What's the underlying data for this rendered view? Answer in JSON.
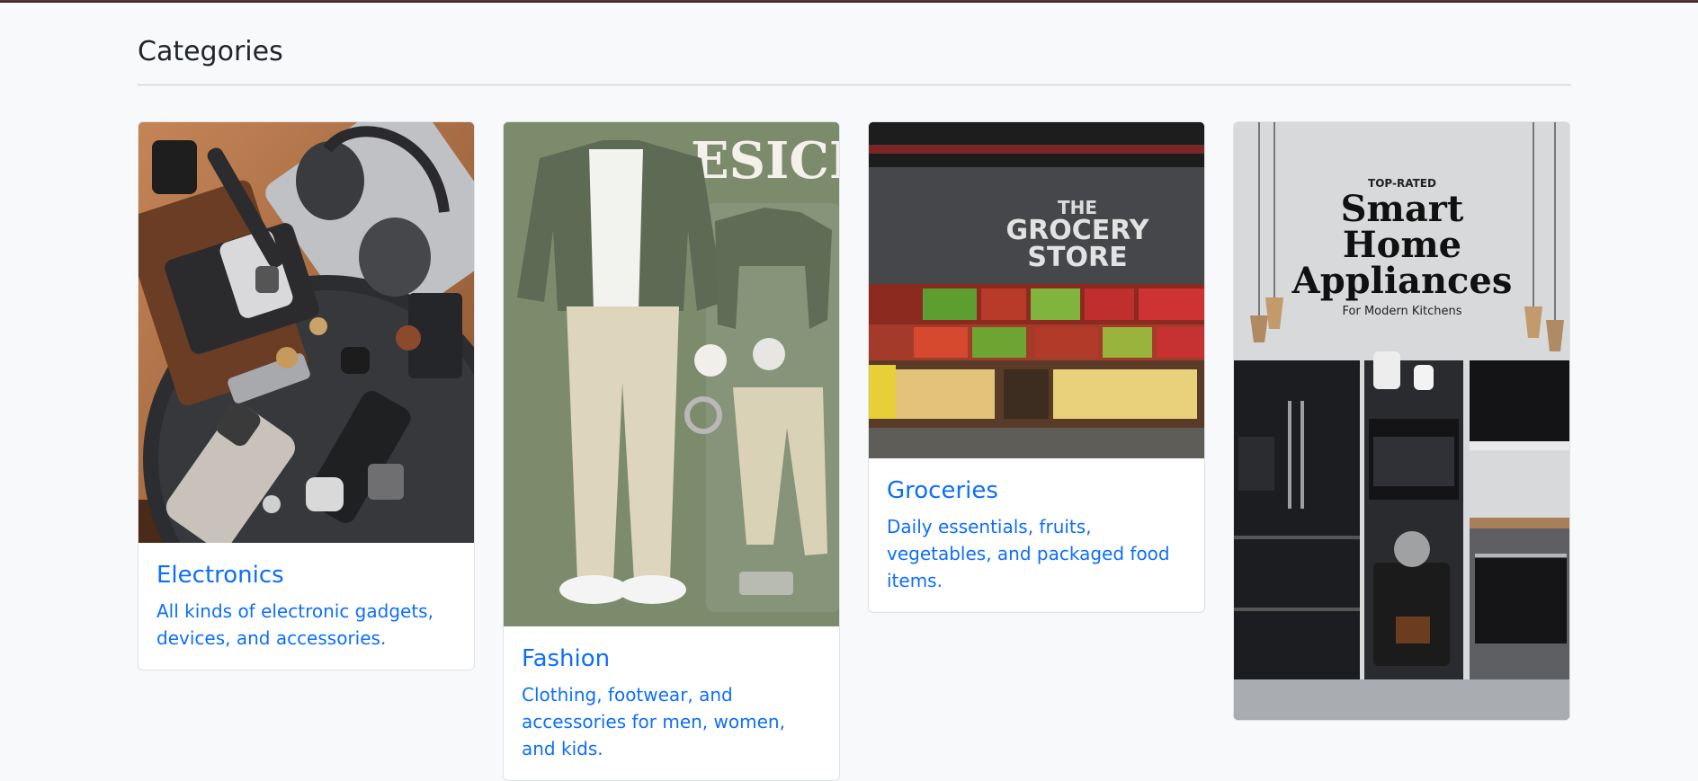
{
  "page": {
    "title": "Categories"
  },
  "categories": [
    {
      "name": "Electronics",
      "description": "All kinds of electronic gadgets, devices, and accessories."
    },
    {
      "name": "Fashion",
      "description": "Clothing, footwear, and accessories for men, women, and kids.",
      "image_text": "ESICLE"
    },
    {
      "name": "Groceries",
      "description": "Daily essentials, fruits, vegetables, and packaged food items.",
      "image_text": {
        "line1": "THE",
        "line2": "GROCERY",
        "line3": "STORE"
      }
    },
    {
      "name": "",
      "description": "",
      "image_text": {
        "top": "TOP-RATED",
        "line1": "Smart",
        "line2": "Home",
        "line3": "Appliances",
        "bottom": "For Modern Kitchens"
      }
    }
  ],
  "colors": {
    "background": "#f8f9fa",
    "link": "#0d6efd",
    "divider": "#c7cbcf"
  }
}
